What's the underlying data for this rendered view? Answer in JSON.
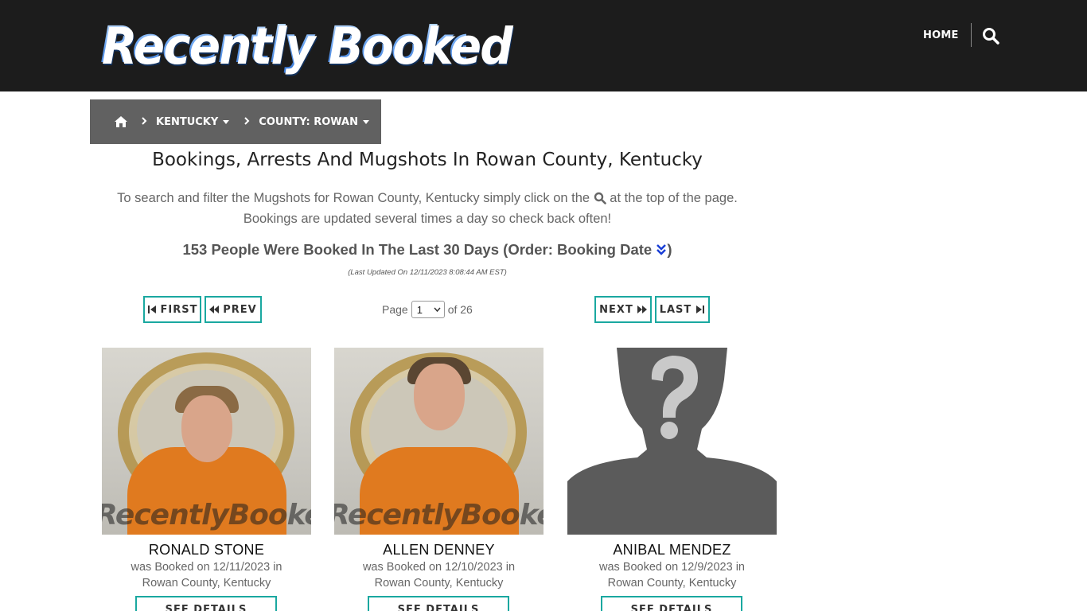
{
  "navbar": {
    "logo_text": "Recently Booked",
    "home_label": "HOME",
    "search_icon": "search-icon"
  },
  "breadcrumb": {
    "home_icon": "home-icon",
    "separator_icon": "chevron-right-icon",
    "state": "KENTUCKY",
    "county": "COUNTY: ROWAN"
  },
  "main": {
    "title": "Bookings, Arrests And Mugshots In Rowan County, Kentucky",
    "intro_part1": "To search and filter the Mugshots for Rowan County, Kentucky simply click on the",
    "intro_part2": "at the top of the page.",
    "intro_line2": "Bookings are updated several times a day so check back often!",
    "count_text": "153 People Were Booked In The Last 30 Days (Order: Booking Date",
    "count_close": ")",
    "order_icon": "double-chevron-down-icon",
    "last_updated": "(Last Updated On 12/11/2023 8:08:44 AM EST)"
  },
  "pagination": {
    "first_label": "FIRST",
    "prev_label": "PREV",
    "next_label": "NEXT",
    "last_label": "LAST",
    "page_label": "Page",
    "current_page": "1",
    "of_label": "of 26"
  },
  "bookings": [
    {
      "name": "RONALD STONE",
      "booked_line1": "was Booked on 12/11/2023 in",
      "booked_line2": "Rowan County, Kentucky",
      "details_label": "SEE DETAILS",
      "watermark": "RecentlyBooked.com"
    },
    {
      "name": "ALLEN DENNEY",
      "booked_line1": "was Booked on 12/10/2023 in",
      "booked_line2": "Rowan County, Kentucky",
      "details_label": "SEE DETAILS",
      "watermark": "RecentlyBooked.com"
    },
    {
      "name": "ANIBAL MENDEZ",
      "booked_line1": "was Booked on 12/9/2023 in",
      "booked_line2": "Rowan County, Kentucky",
      "details_label": "SEE DETAILS"
    }
  ],
  "colors": {
    "navbar_bg": "#1c1c1c",
    "breadcrumb_bg": "#616161",
    "button_border": "#1aa8a0",
    "order_icon": "#1a3fd6"
  }
}
